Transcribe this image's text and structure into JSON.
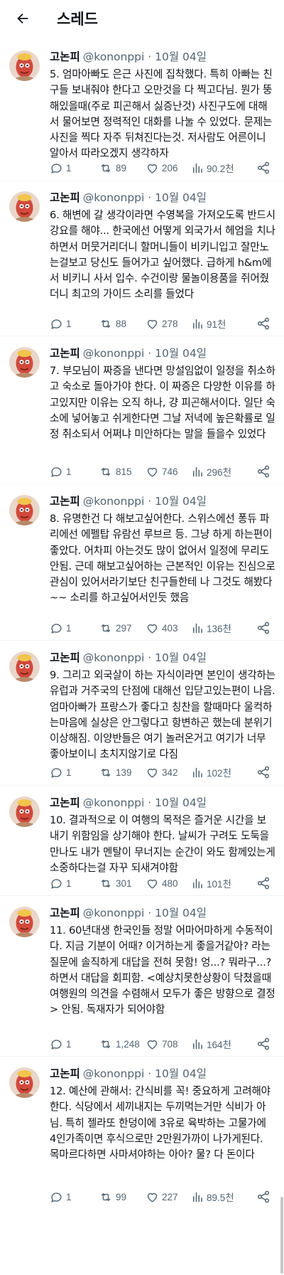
{
  "header": {
    "title": "스레드",
    "back_icon": "arrow-left-icon"
  },
  "tweets": [
    {
      "author": "고논피",
      "handle": "@kononppi",
      "sep": "·",
      "date": "10월 04일",
      "text": "5. 엄마아빠도 은근 사진에 집착했다. 특히 아빠는 친구들 보내줘야 한다고 오만것을 다 찍고다님. 뭔가 뚱해있을때(주로 피곤해서 싫증난것) 사진구도에 대해서 물어보면 정력적인 대화를 나눌 수 있었다. 문제는 사진을 찍다 자주 뒤쳐진다는것. 저사람도 어른이니 알아서 따라오겠지 생각하자",
      "replies": "1",
      "retweets": "89",
      "likes": "206",
      "views": "90.2천"
    },
    {
      "author": "고논피",
      "handle": "@kononppi",
      "sep": "·",
      "date": "10월 04일",
      "text": "6. 해변에 갈 생각이라면 수영복을 가져오도록 반드시 강요를 해야... 한국에선 어떻게 외국가서 헤엄을 치나 하면서 머뭇거리더니 할머니들이 비키니입고 잘만노는걸보고 당신도 들어가고 싶어했다. 급하게 h&m에서 비키니 사서 입수. 수건이랑 물놀이용품을 쥐어줬더니 최고의 가이드 소리를 들었다",
      "replies": "1",
      "retweets": "88",
      "likes": "278",
      "views": "91천"
    },
    {
      "author": "고논피",
      "handle": "@kononppi",
      "sep": "·",
      "date": "10월 04일",
      "text": "7. 부모님이 짜증을 낸다면 망설임없이 일정을 취소하고 숙소로 돌아가야 한다. 이 짜증은 다양한 이유를 하고있지만 이유는 오직 하나, 걍 피곤해서이다. 일단 숙소에 넣어놓고 쉬게한다면 그날 저녁에 높은확률로 일정 취소되서 어쩌냐 미안하다는 말을 들을수 있었다",
      "replies": "1",
      "retweets": "815",
      "likes": "746",
      "views": "296천"
    },
    {
      "author": "고논피",
      "handle": "@kononppi",
      "sep": "·",
      "date": "10월 04일",
      "text": "8. 유명한건 다 해보고싶어한다. 스위스에선 퐁듀 파리에선 에펠탑 유람선 루브르 등. 그냥 하게 하는편이 좋았다. 어차피 아는것도 많이 없어서 일정에 무리도 안됨. 근데 해보고싶어하는 근본적인 이유는 진심으로 관심이 있어서라기보단 친구들한테 나 그것도 해봤다~~ 소리를 하고싶어서인듯 했음",
      "replies": "1",
      "retweets": "297",
      "likes": "403",
      "views": "136천"
    },
    {
      "author": "고논피",
      "handle": "@kononppi",
      "sep": "·",
      "date": "10월 04일",
      "text": "9. 그리고 외국살이 하는 자식이라면 본인이 생각하는 유럽과 거주국의 단점에 대해선 입닫고있는편이 나음. 엄마아빠가 프랑스가 좋다고 칭찬을 할때마다 울컥하는마음에 실상은 안그렇다고 항변하곤 했는데 분위기 이상해짐. 이양반들은 여기 놀러온거고 여기가 너무 좋아보이니 초치지않기로 다짐",
      "replies": "1",
      "retweets": "139",
      "likes": "342",
      "views": "102천"
    },
    {
      "author": "고논피",
      "handle": "@kononppi",
      "sep": "·",
      "date": "10월 04일",
      "text": "10. 결과적으로 이 여행의 목적은 즐거운 시간을 보내기 위함임을 상기해야 한다. 날씨가 구려도 도둑을 만나도 내가 멘탈이 무너지는 순간이 와도 함께있는게 소중하다는걸 자꾸 되새겨야함",
      "replies": "1",
      "retweets": "301",
      "likes": "480",
      "views": "101천"
    },
    {
      "author": "고논피",
      "handle": "@kononppi",
      "sep": "·",
      "date": "10월 04일",
      "text": "11. 60년대생 한국인들 정말 어마어마하게 수동적이다. 지금 기분이 어때? 이거하는게 좋을거같아? 라는 질문에 솔직하게 대답을 전혀 못함! 엉...? 뭐라구...? 하면서 대답을 회피함. <예상치못한상황이 닥쳤을때 여행원의 의견을 수렴해서 모두가 좋은 방향으로 결정> 안됨. 독재자가 되어야함",
      "replies": "1",
      "retweets": "1,248",
      "likes": "708",
      "views": "164천"
    },
    {
      "author": "고논피",
      "handle": "@kononppi",
      "sep": "·",
      "date": "10월 04일",
      "text": "12. 예산에 관해서: 간식비를 꼭! 중요하게 고려해야 한다. 식당에서 세끼내지는 두끼먹는거만 식비가 아님. 특히 젤라또 한덩이에 3유로 육박하는 고물가에 4인가족이면 후식으로만 2만원가까이 나가게된다. 목마르다하면 사마셔야하는 아아? 물? 다 돈이다",
      "replies": "1",
      "retweets": "99",
      "likes": "227",
      "views": "89.5천"
    }
  ]
}
